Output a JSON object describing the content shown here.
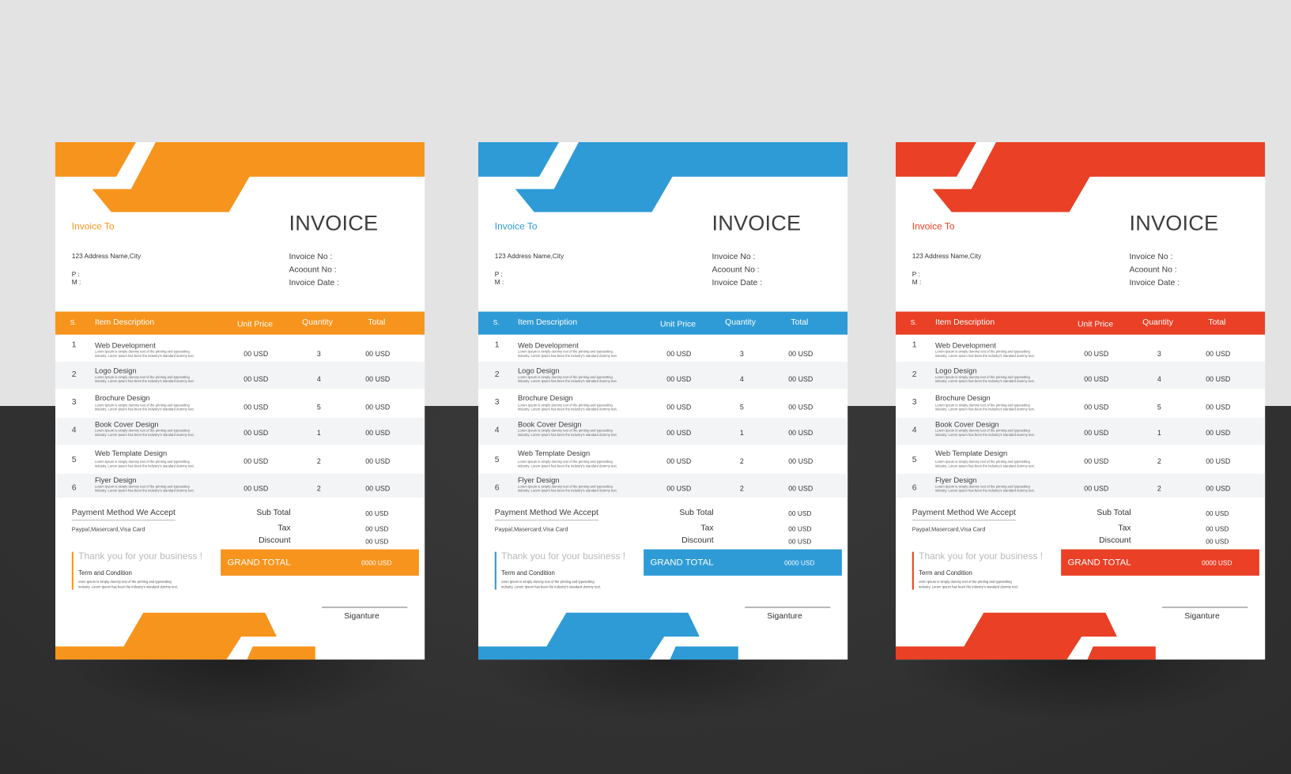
{
  "colors": {
    "page_top": "#e3e3e3",
    "page_bottom": "#323232",
    "orange": "#f7941d",
    "blue": "#2e9bd6",
    "red": "#e94026"
  },
  "invoices": [
    {
      "accent": "#f7941d",
      "title": "INVOICE",
      "invoice_to": "Invoice To",
      "address": "123 Address Name,City",
      "phone_label": "P :",
      "mobile_label": "M :",
      "meta": [
        "Invoice No :",
        "Acoount No :",
        "Invoice Date :"
      ],
      "table_headers": {
        "s": "S.",
        "desc": "Item Description",
        "unit": "Unit Price",
        "qty": "Quantity",
        "total": "Total"
      },
      "items": [
        {
          "n": "1",
          "name": "Web Development",
          "desc1": "Lorem Ipsum is simply dummy text of the printing and typesetting",
          "desc2": "industry. Lorem Ipsum has been the industry's standard dummy text.",
          "unit": "00 USD",
          "qty": "3",
          "total": "00 USD"
        },
        {
          "n": "2",
          "name": "Logo Design",
          "desc1": "Lorem Ipsum is simply dummy text of the printing and typesetting",
          "desc2": "industry. Lorem Ipsum has been the industry's standard dummy text.",
          "unit": "00 USD",
          "qty": "4",
          "total": "00 USD"
        },
        {
          "n": "3",
          "name": "Brochure Design",
          "desc1": "Lorem Ipsum is simply dummy text of the printing and typesetting",
          "desc2": "industry. Lorem Ipsum has been the industry's standard dummy text.",
          "unit": "00 USD",
          "qty": "5",
          "total": "00 USD"
        },
        {
          "n": "4",
          "name": "Book Cover Design",
          "desc1": "Lorem Ipsum is simply dummy text of the printing and typesetting",
          "desc2": "industry. Lorem Ipsum has been the industry's standard dummy text.",
          "unit": "00 USD",
          "qty": "1",
          "total": "00 USD"
        },
        {
          "n": "5",
          "name": "Web Template Design",
          "desc1": "Lorem Ipsum is simply dummy text of the printing and typesetting",
          "desc2": "industry. Lorem Ipsum has been the industry's standard dummy text.",
          "unit": "00 USD",
          "qty": "2",
          "total": "00 USD"
        },
        {
          "n": "6",
          "name": "Flyer Design",
          "desc1": "Lorem Ipsum is simply dummy text of the printing and typesetting",
          "desc2": "industry. Lorem Ipsum has been the industry's standard dummy text.",
          "unit": "00 USD",
          "qty": "2",
          "total": "00 USD"
        }
      ],
      "payment_title": "Payment Method We Accept",
      "payment_methods": "Paypal,Masercard,Visa Card",
      "sub_total_label": "Sub Total",
      "sub_total": "00 USD",
      "tax_label": "Tax",
      "tax": "00 USD",
      "discount_label": "Discount",
      "discount": "00 USD",
      "thanks": "Thank you for your business !",
      "terms_title": "Term and Condition",
      "terms_line1": "orem Ipsum is simply dummy text of the printing and typesetting",
      "terms_line2": "industry. Lorem Ipsum has been the industry's standard dummy text.",
      "grand_total_label": "GRAND TOTAL",
      "grand_total": "0000 USD",
      "signature": "Siganture"
    },
    {
      "accent": "#2e9bd6",
      "title": "INVOICE",
      "invoice_to": "Invoice To",
      "address": "123 Address Name,City",
      "phone_label": "P :",
      "mobile_label": "M :",
      "meta": [
        "Invoice No :",
        "Acoount No :",
        "Invoice Date :"
      ],
      "table_headers": {
        "s": "S.",
        "desc": "Item Description",
        "unit": "Unit Price",
        "qty": "Quantity",
        "total": "Total"
      },
      "items": [
        {
          "n": "1",
          "name": "Web Development",
          "desc1": "Lorem Ipsum is simply dummy text of the printing and typesetting",
          "desc2": "industry. Lorem Ipsum has been the industry's standard dummy text.",
          "unit": "00 USD",
          "qty": "3",
          "total": "00 USD"
        },
        {
          "n": "2",
          "name": "Logo Design",
          "desc1": "Lorem Ipsum is simply dummy text of the printing and typesetting",
          "desc2": "industry. Lorem Ipsum has been the industry's standard dummy text.",
          "unit": "00 USD",
          "qty": "4",
          "total": "00 USD"
        },
        {
          "n": "3",
          "name": "Brochure Design",
          "desc1": "Lorem Ipsum is simply dummy text of the printing and typesetting",
          "desc2": "industry. Lorem Ipsum has been the industry's standard dummy text.",
          "unit": "00 USD",
          "qty": "5",
          "total": "00 USD"
        },
        {
          "n": "4",
          "name": "Book Cover Design",
          "desc1": "Lorem Ipsum is simply dummy text of the printing and typesetting",
          "desc2": "industry. Lorem Ipsum has been the industry's standard dummy text.",
          "unit": "00 USD",
          "qty": "1",
          "total": "00 USD"
        },
        {
          "n": "5",
          "name": "Web Template Design",
          "desc1": "Lorem Ipsum is simply dummy text of the printing and typesetting",
          "desc2": "industry. Lorem Ipsum has been the industry's standard dummy text.",
          "unit": "00 USD",
          "qty": "2",
          "total": "00 USD"
        },
        {
          "n": "6",
          "name": "Flyer Design",
          "desc1": "Lorem Ipsum is simply dummy text of the printing and typesetting",
          "desc2": "industry. Lorem Ipsum has been the industry's standard dummy text.",
          "unit": "00 USD",
          "qty": "2",
          "total": "00 USD"
        }
      ],
      "payment_title": "Payment Method We Accept",
      "payment_methods": "Paypal,Masercard,Visa Card",
      "sub_total_label": "Sub Total",
      "sub_total": "00 USD",
      "tax_label": "Tax",
      "tax": "00 USD",
      "discount_label": "Discount",
      "discount": "00 USD",
      "thanks": "Thank you for your business !",
      "terms_title": "Term and Condition",
      "terms_line1": "orem Ipsum is simply dummy text of the printing and typesetting",
      "terms_line2": "industry. Lorem Ipsum has been the industry's standard dummy text.",
      "grand_total_label": "GRAND TOTAL",
      "grand_total": "0000 USD",
      "signature": "Siganture"
    },
    {
      "accent": "#e94026",
      "title": "INVOICE",
      "invoice_to": "Invoice To",
      "address": "123 Address Name,City",
      "phone_label": "P :",
      "mobile_label": "M :",
      "meta": [
        "Invoice No :",
        "Acoount No :",
        "Invoice Date :"
      ],
      "table_headers": {
        "s": "S.",
        "desc": "Item Description",
        "unit": "Unit Price",
        "qty": "Quantity",
        "total": "Total"
      },
      "items": [
        {
          "n": "1",
          "name": "Web Development",
          "desc1": "Lorem Ipsum is simply dummy text of the printing and typesetting",
          "desc2": "industry. Lorem Ipsum has been the industry's standard dummy text.",
          "unit": "00 USD",
          "qty": "3",
          "total": "00 USD"
        },
        {
          "n": "2",
          "name": "Logo Design",
          "desc1": "Lorem Ipsum is simply dummy text of the printing and typesetting",
          "desc2": "industry. Lorem Ipsum has been the industry's standard dummy text.",
          "unit": "00 USD",
          "qty": "4",
          "total": "00 USD"
        },
        {
          "n": "3",
          "name": "Brochure Design",
          "desc1": "Lorem Ipsum is simply dummy text of the printing and typesetting",
          "desc2": "industry. Lorem Ipsum has been the industry's standard dummy text.",
          "unit": "00 USD",
          "qty": "5",
          "total": "00 USD"
        },
        {
          "n": "4",
          "name": "Book Cover Design",
          "desc1": "Lorem Ipsum is simply dummy text of the printing and typesetting",
          "desc2": "industry. Lorem Ipsum has been the industry's standard dummy text.",
          "unit": "00 USD",
          "qty": "1",
          "total": "00 USD"
        },
        {
          "n": "5",
          "name": "Web Template Design",
          "desc1": "Lorem Ipsum is simply dummy text of the printing and typesetting",
          "desc2": "industry. Lorem Ipsum has been the industry's standard dummy text.",
          "unit": "00 USD",
          "qty": "2",
          "total": "00 USD"
        },
        {
          "n": "6",
          "name": "Flyer Design",
          "desc1": "Lorem Ipsum is simply dummy text of the printing and typesetting",
          "desc2": "industry. Lorem Ipsum has been the industry's standard dummy text.",
          "unit": "00 USD",
          "qty": "2",
          "total": "00 USD"
        }
      ],
      "payment_title": "Payment Method We Accept",
      "payment_methods": "Paypal,Masercard,Visa Card",
      "sub_total_label": "Sub Total",
      "sub_total": "00 USD",
      "tax_label": "Tax",
      "tax": "00 USD",
      "discount_label": "Discount",
      "discount": "00 USD",
      "thanks": "Thank you for your business !",
      "terms_title": "Term and Condition",
      "terms_line1": "orem Ipsum is simply dummy text of the printing and typesetting",
      "terms_line2": "industry. Lorem Ipsum has been the industry's standard dummy text.",
      "grand_total_label": "GRAND TOTAL",
      "grand_total": "0000 USD",
      "signature": "Siganture"
    }
  ]
}
